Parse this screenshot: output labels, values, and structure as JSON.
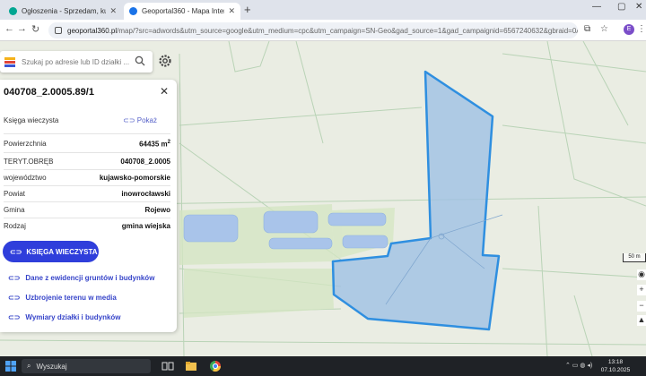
{
  "browser": {
    "tabs": [
      {
        "label": "Ogłoszenia - Sprzedam, kupię - ",
        "favicon_color": "#02a692",
        "active": false
      },
      {
        "label": "Geoportal360 - Mapa Interakty",
        "favicon_color": "#1a73e8",
        "active": true
      }
    ],
    "new_tab_icon": "plus-icon",
    "url_host": "geoportal360.pl",
    "url_rest": "/map/?src=adwords&utm_source=google&utm_medium=cpc&utm_campaign=SN-Geo&gad_source=1&gad_campaignid=6567240632&gbraid=0AA...",
    "profile_initial": "E"
  },
  "search": {
    "placeholder": "Szukaj po adresie lub ID działki ..."
  },
  "parcel": {
    "id": "040708_2.0005.89/1",
    "kw_label": "Księga wieczysta",
    "kw_action": "Pokaż",
    "fields": [
      {
        "label": "Powierzchnia",
        "value": "64435 m",
        "sup": "2"
      },
      {
        "label": "TERYT.OBRĘB",
        "value": "040708_2.0005"
      },
      {
        "label": "województwo",
        "value": "kujawsko-pomorskie"
      },
      {
        "label": "Powiat",
        "value": "inowrocławski"
      },
      {
        "label": "Gmina",
        "value": "Rojewo"
      },
      {
        "label": "Rodzaj",
        "value": "gmina wiejska"
      }
    ],
    "primary_button": "KSIĘGA WIECZYSTA",
    "links": [
      "Dane z ewidencji gruntów i budynków",
      "Uzbrojenie terenu w media",
      "Wymiary działki i budynków"
    ]
  },
  "map": {
    "scale_label": "50 m",
    "parcel_fill": "#9fc0e4",
    "parcel_stroke": "#2f8fe0",
    "water_color": "#a9c4ea",
    "field_color": "#d8e8c6"
  },
  "taskbar": {
    "search_placeholder": "Wyszukaj",
    "time": "13:18",
    "date": "07.10.2025"
  }
}
